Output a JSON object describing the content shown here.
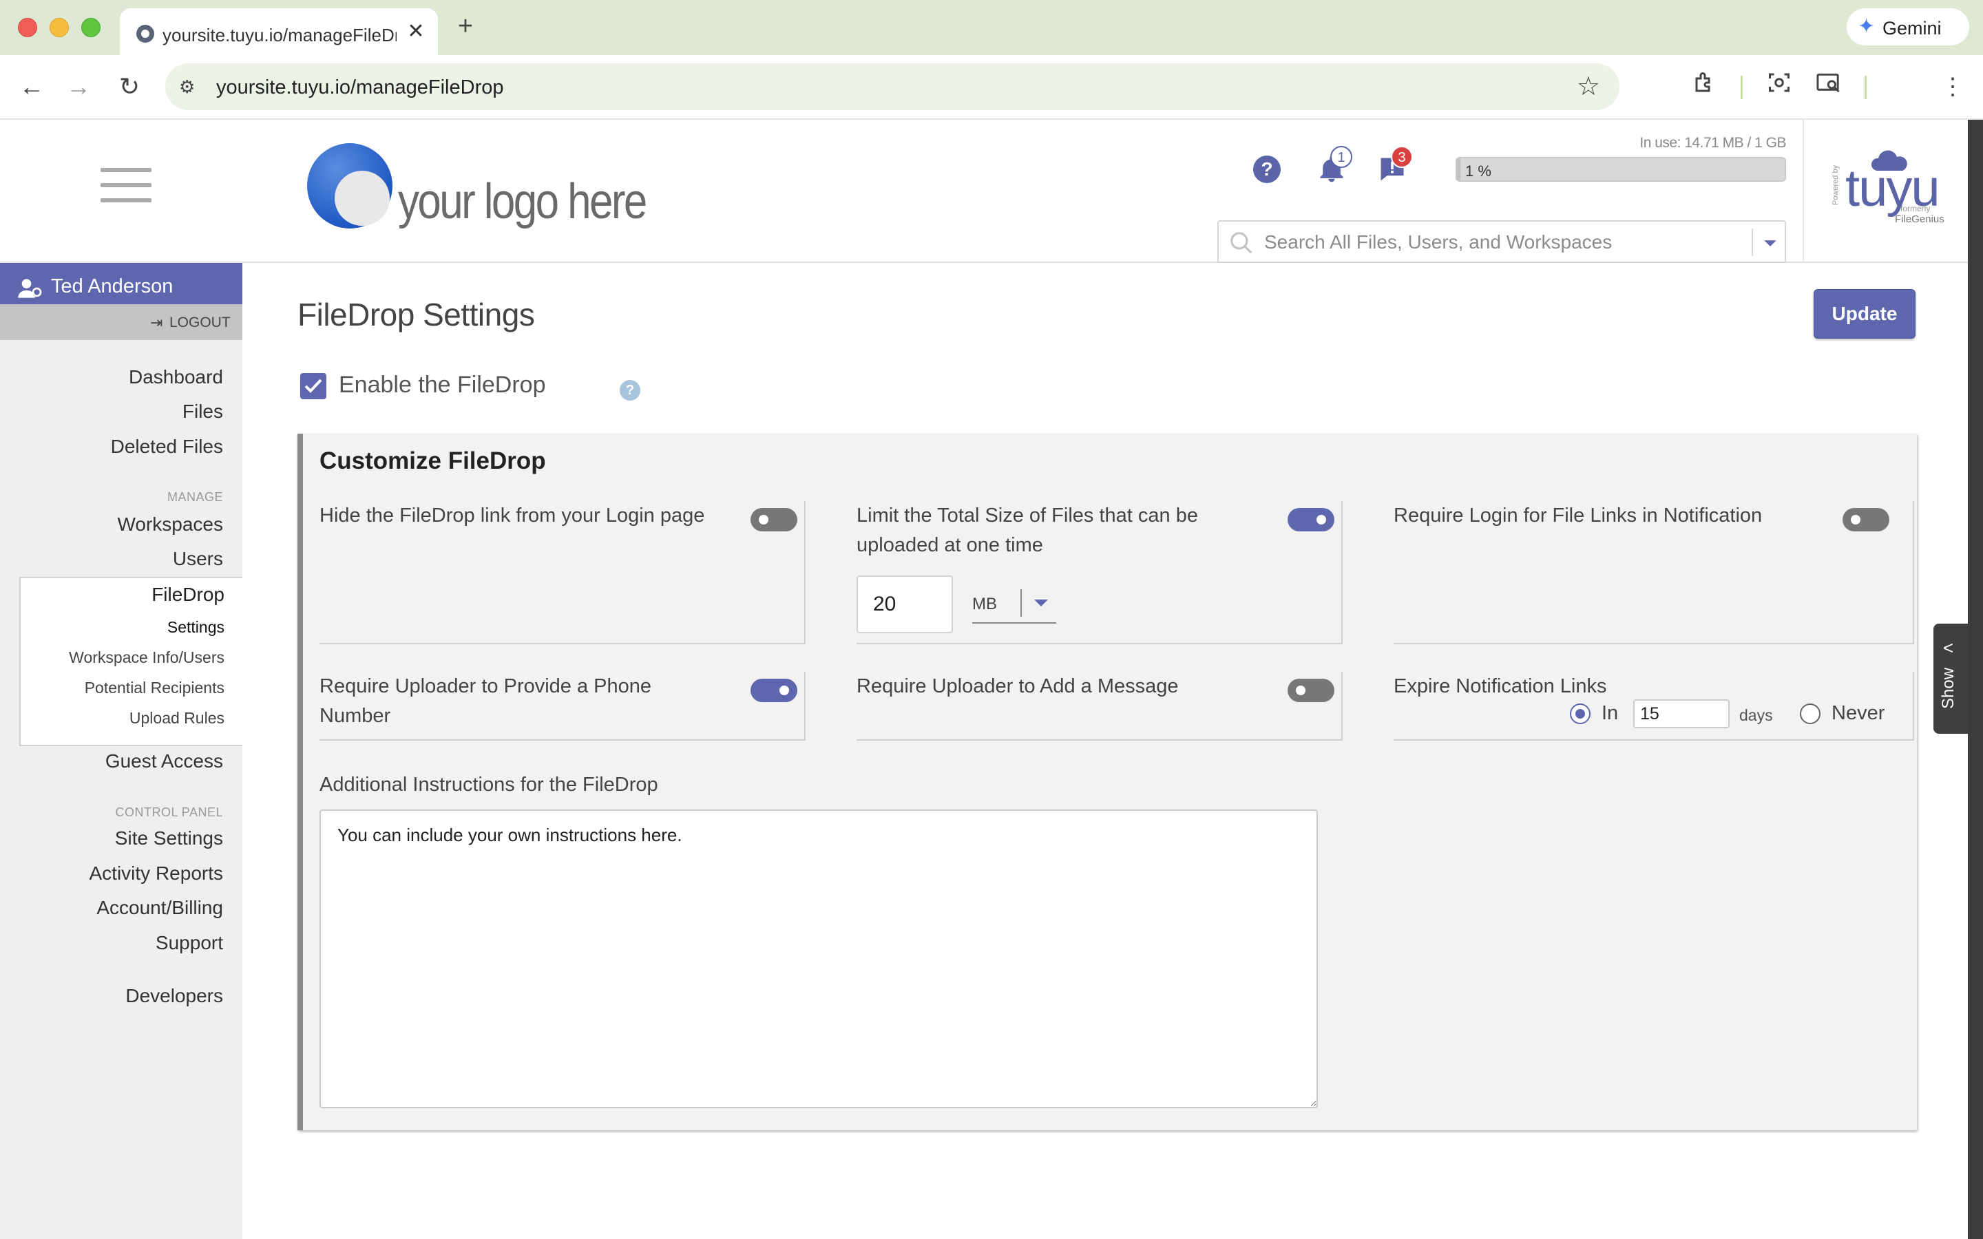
{
  "browser": {
    "tab_title": "yoursite.tuyu.io/manageFileDrop",
    "tab_close": "✕",
    "new_tab": "+",
    "gemini_label": "Gemini",
    "url": "yoursite.tuyu.io/manageFileDrop"
  },
  "header": {
    "logo_text": "your logo here",
    "help_glyph": "?",
    "notifications_count": "1",
    "messages_count": "3",
    "usage_text": "In use: 14.71 MB / 1 GB",
    "usage_percent_label": "1 %",
    "usage_fraction": 0.01,
    "search_placeholder": "Search All Files, Users, and Workspaces",
    "brand": {
      "word": "tuyu",
      "powered": "Powered by",
      "formerly": "formerly",
      "former_name": "FileGenius"
    }
  },
  "sidebar": {
    "user_name": "Ted Anderson",
    "logout": "LOGOUT",
    "items": {
      "dashboard": "Dashboard",
      "files": "Files",
      "deleted_files": "Deleted Files",
      "manage_section": "MANAGE",
      "workspaces": "Workspaces",
      "users": "Users",
      "filedrop": "FileDrop",
      "settings": "Settings",
      "workspace_info": "Workspace Info/Users",
      "potential_recipients": "Potential Recipients",
      "upload_rules": "Upload Rules",
      "guest_access": "Guest Access",
      "control_section": "CONTROL PANEL",
      "site_settings": "Site Settings",
      "activity_reports": "Activity Reports",
      "account_billing": "Account/Billing",
      "support": "Support",
      "developers": "Developers"
    }
  },
  "main": {
    "title": "FileDrop Settings",
    "update_label": "Update",
    "enable_label": "Enable the FileDrop",
    "enable_checked": true,
    "info_glyph": "?",
    "panel_title": "Customize FileDrop",
    "options": {
      "hide_link": {
        "label": "Hide the FileDrop link from your Login page",
        "enabled": false
      },
      "limit_size": {
        "label": "Limit the Total Size of Files that can be uploaded at one time",
        "enabled": true,
        "value": "20",
        "unit": "MB"
      },
      "require_login": {
        "label": "Require Login for File Links in Notification",
        "enabled": false
      },
      "require_phone": {
        "label": "Require Uploader to Provide a Phone Number",
        "enabled": true
      },
      "require_message": {
        "label": "Require Uploader to Add a Message",
        "enabled": false
      },
      "expire_links": {
        "label": "Expire Notification Links",
        "in_label": "In",
        "days_value": "15",
        "days_label": "days",
        "never_label": "Never",
        "selected": "in"
      }
    },
    "instructions_label": "Additional Instructions for the FileDrop",
    "instructions_value": "You can include your own instructions here."
  },
  "show_tab": {
    "label": "Show",
    "chevron": "<"
  },
  "colors": {
    "accent": "#5e67ad",
    "toggle_off": "#777777",
    "sidebar_bg": "#efefef"
  }
}
